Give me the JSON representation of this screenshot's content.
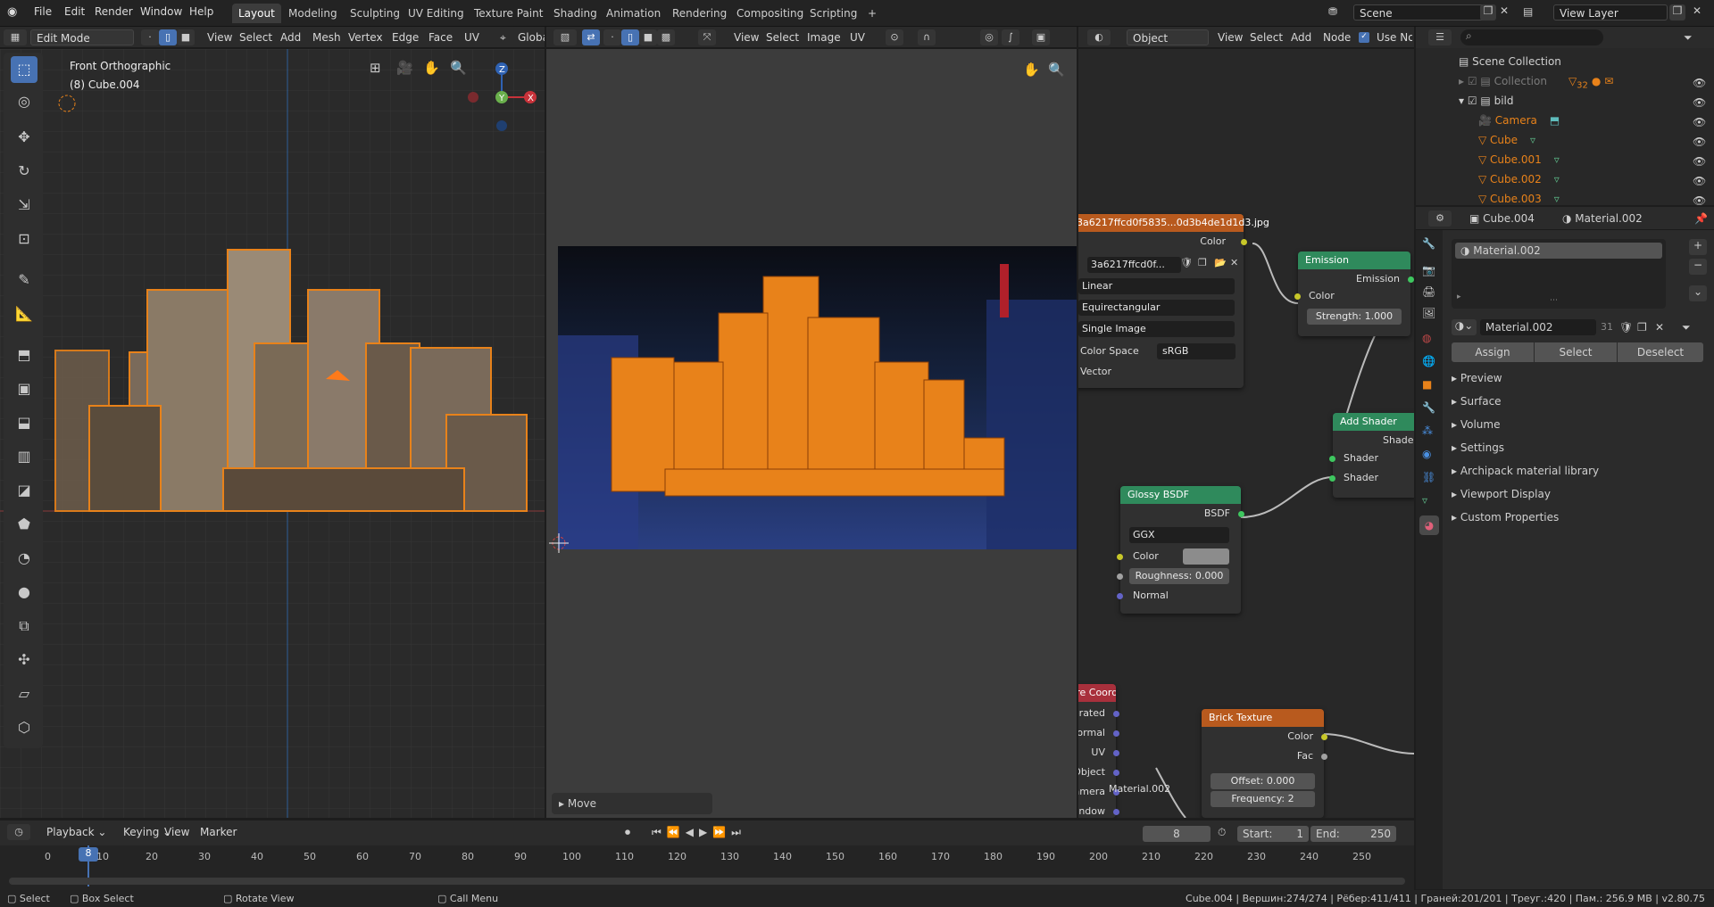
{
  "menu": [
    "File",
    "Edit",
    "Render",
    "Window",
    "Help"
  ],
  "workspaces": [
    "Layout",
    "Modeling",
    "Sculpting",
    "UV Editing",
    "Texture Paint",
    "Shading",
    "Animation",
    "Rendering",
    "Compositing",
    "Scripting"
  ],
  "add_tab": "+",
  "scene": "Scene",
  "view_layer": "View Layer",
  "viewport3d": {
    "mode": "Edit Mode",
    "menus": [
      "View",
      "Select",
      "Add",
      "Mesh",
      "Vertex",
      "Edge",
      "Face",
      "UV"
    ],
    "orientation": "Global",
    "view_name": "Front Orthographic",
    "object_name": "(8) Cube.004",
    "gizmo": {
      "z": "Z",
      "y": "Y",
      "x": "X"
    }
  },
  "image_editor": {
    "menus": [
      "View",
      "Select",
      "Image",
      "UV"
    ],
    "operator_panel": "Move"
  },
  "node_editor": {
    "object_drop": "Object",
    "menus": [
      "View",
      "Select",
      "Add",
      "Node"
    ],
    "use_nodes": "Use Nodes",
    "image_node": {
      "title": "3a6217ffcd0f5835...0d3b4de1d1d3.jpg",
      "color_out": "Color",
      "image_name": "3a6217ffcd0f...",
      "interp": "Linear",
      "projection": "Equirectangular",
      "source": "Single Image",
      "color_space_label": "Color Space",
      "color_space": "sRGB",
      "vector": "Vector"
    },
    "emission": {
      "title": "Emission",
      "out": "Emission",
      "color": "Color",
      "strength": "Strength:",
      "strength_val": "1.000"
    },
    "add_shader": {
      "title": "Add Shader",
      "out": "Shader",
      "in1": "Shader",
      "in2": "Shader"
    },
    "glossy": {
      "title": "Glossy BSDF",
      "out": "BSDF",
      "dist": "GGX",
      "color": "Color",
      "rough": "Roughness:",
      "rough_val": "0.000",
      "normal": "Normal"
    },
    "texcoord": {
      "title": "Texture Coordinate",
      "outs": [
        "Generated",
        "Normal",
        "UV",
        "Object",
        "Camera",
        "Window"
      ]
    },
    "brick": {
      "title": "Brick Texture",
      "color": "Color",
      "fac": "Fac",
      "offset": "Offset:",
      "offset_val": "0.000",
      "freq": "Frequency:",
      "freq_val": "2"
    },
    "material_label": "Material.002"
  },
  "outliner": {
    "root": "Scene Collection",
    "rows": [
      {
        "name": "Collection",
        "indent": 1
      },
      {
        "name": "bild",
        "indent": 1
      },
      {
        "name": "Camera",
        "indent": 2
      },
      {
        "name": "Cube",
        "indent": 2
      },
      {
        "name": "Cube.001",
        "indent": 2
      },
      {
        "name": "Cube.002",
        "indent": 2
      },
      {
        "name": "Cube.003",
        "indent": 2
      }
    ],
    "collection_badge": "32"
  },
  "properties": {
    "object": "Cube.004",
    "material": "Material.002",
    "slot": "Material.002",
    "mat_field": "Material.002",
    "users": "31",
    "assign": "Assign",
    "select": "Select",
    "deselect": "Deselect",
    "panels": [
      "Preview",
      "Surface",
      "Volume",
      "Settings",
      "Archipack material library",
      "Viewport Display",
      "Custom Properties"
    ]
  },
  "timeline": {
    "menus": [
      "Playback",
      "Keying",
      "View",
      "Marker"
    ],
    "current": "8",
    "start_label": "Start:",
    "start": "1",
    "end_label": "End:",
    "end": "250",
    "ticks": [
      "0",
      "10",
      "20",
      "30",
      "40",
      "50",
      "60",
      "70",
      "80",
      "90",
      "100",
      "110",
      "120",
      "130",
      "140",
      "150",
      "160",
      "170",
      "180",
      "190",
      "200",
      "210",
      "220",
      "230",
      "240",
      "250"
    ]
  },
  "status": {
    "select": "Select",
    "box": "Box Select",
    "rotate": "Rotate View",
    "menu": "Call Menu",
    "stats": "Cube.004 | Вершин:274/274 | Рёбер:411/411 | Граней:201/201 | Треуг.:420 | Пам.: 256.9 MB | v2.80.75"
  }
}
